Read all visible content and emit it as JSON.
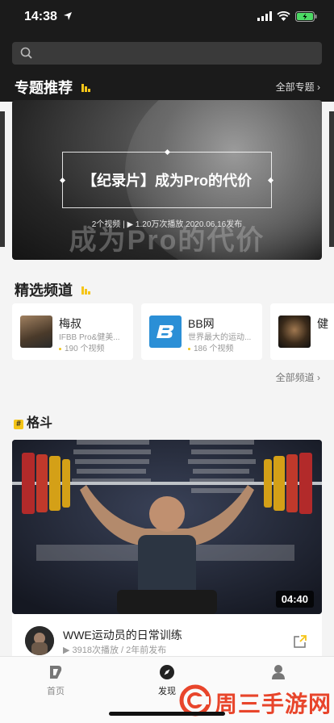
{
  "status": {
    "time": "14:38"
  },
  "search": {
    "placeholder": ""
  },
  "featured": {
    "heading": "专题推荐",
    "more": "全部专题 ›",
    "banner": {
      "title": "【纪录片】成为Pro的代价",
      "meta": "2个视频 | ▶ 1.20万次播放 2020.06.16发布",
      "overlay_text": "成为Pro的代价"
    }
  },
  "channels": {
    "heading": "精选频道",
    "more": "全部频道 ›",
    "items": [
      {
        "name": "梅叔",
        "desc": "IFBB Pro&健美...",
        "count": "190 个视频"
      },
      {
        "name": "BB网",
        "desc": "世界最大的运动...",
        "count": "186 个视频"
      },
      {
        "name": "健",
        "desc": "",
        "count": ""
      }
    ]
  },
  "category": {
    "heading": "格斗",
    "hash": "#",
    "video": {
      "duration": "04:40",
      "title": "WWE运动员的日常训练",
      "meta": "▶ 3918次播放 / 2年前发布"
    }
  },
  "nav": {
    "items": [
      {
        "label": "首页"
      },
      {
        "label": "发现"
      },
      {
        "label": ""
      }
    ]
  },
  "watermark": {
    "text": "周三手游网"
  },
  "colors": {
    "accent": "#f5c518",
    "dark": "#1b1b1b",
    "watermark": "#e8452b"
  }
}
